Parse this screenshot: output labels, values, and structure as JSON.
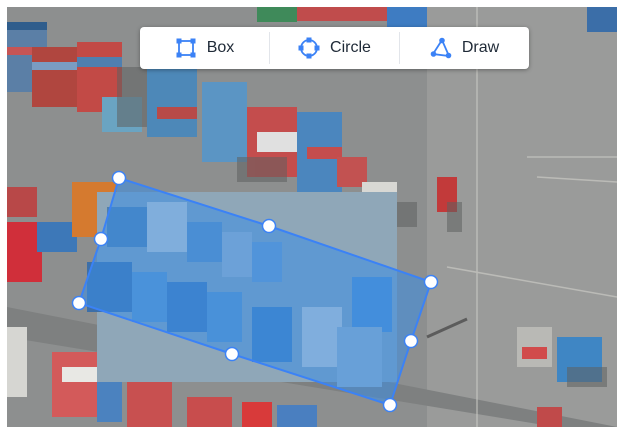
{
  "toolbar": {
    "tools": [
      {
        "label": "Box",
        "icon": "box-select-icon"
      },
      {
        "label": "Circle",
        "icon": "circle-select-icon"
      },
      {
        "label": "Draw",
        "icon": "polygon-draw-icon"
      }
    ]
  },
  "colors": {
    "accent": "#3b82f6",
    "selection_fill": "#3a8ee6",
    "pavement": "#8a8c8c"
  }
}
